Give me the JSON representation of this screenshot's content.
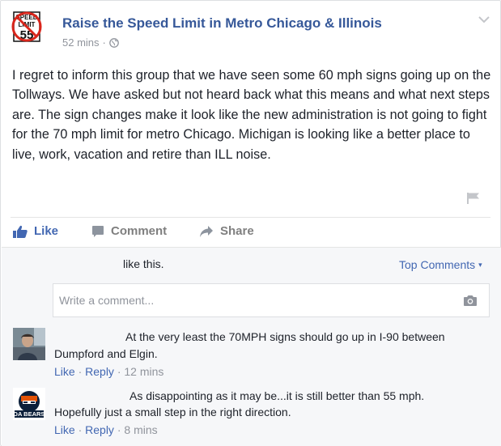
{
  "post": {
    "group_name": "Raise the Speed Limit in Metro Chicago & Illinois",
    "timestamp": "52 mins",
    "separator": "·",
    "avatar_sign": {
      "line1": "SPEED",
      "line2": "LIMIT",
      "number": "55"
    },
    "body": "I regret to inform this group that we have seen some 60 mph signs going up on the Tollways. We have asked but not heard back what this means and what next steps are. The sign changes make it look like the new administration is not going to fight for the 70 mph limit for metro Chicago. Michigan is looking like a better place to live, work, vacation and retire than ILL noise."
  },
  "actions": {
    "like": "Like",
    "comment": "Comment",
    "share": "Share"
  },
  "reactions": {
    "likes_text": "like this."
  },
  "sort": {
    "label": "Top Comments",
    "caret": "▾"
  },
  "comment_input": {
    "placeholder": "Write a comment..."
  },
  "comments": [
    {
      "text": "At the very least the 70MPH signs should go up in I-90 between Dumpford and Elgin.",
      "line1": "At the very least the 70MPH signs should go up in I-90 between",
      "line2": "Dumpford and Elgin.",
      "like": "Like",
      "reply": "Reply",
      "time": "12 mins",
      "sep": "·"
    },
    {
      "text": "As disappointing as it may be...it is still better than 55 mph. Hopefully just a small step in the right direction.",
      "line1": "As disappointing as it may be...it is still better than 55 mph.",
      "line2": "Hopefully just a small step in the right direction.",
      "like": "Like",
      "reply": "Reply",
      "time": "8 mins",
      "sep": "·",
      "avatar_text": "DA BEARS"
    }
  ],
  "colors": {
    "link": "#365899",
    "accent": "#4267b2",
    "muted": "#90949c",
    "comment_bg": "#f6f7f9",
    "border": "#dddfe2"
  }
}
